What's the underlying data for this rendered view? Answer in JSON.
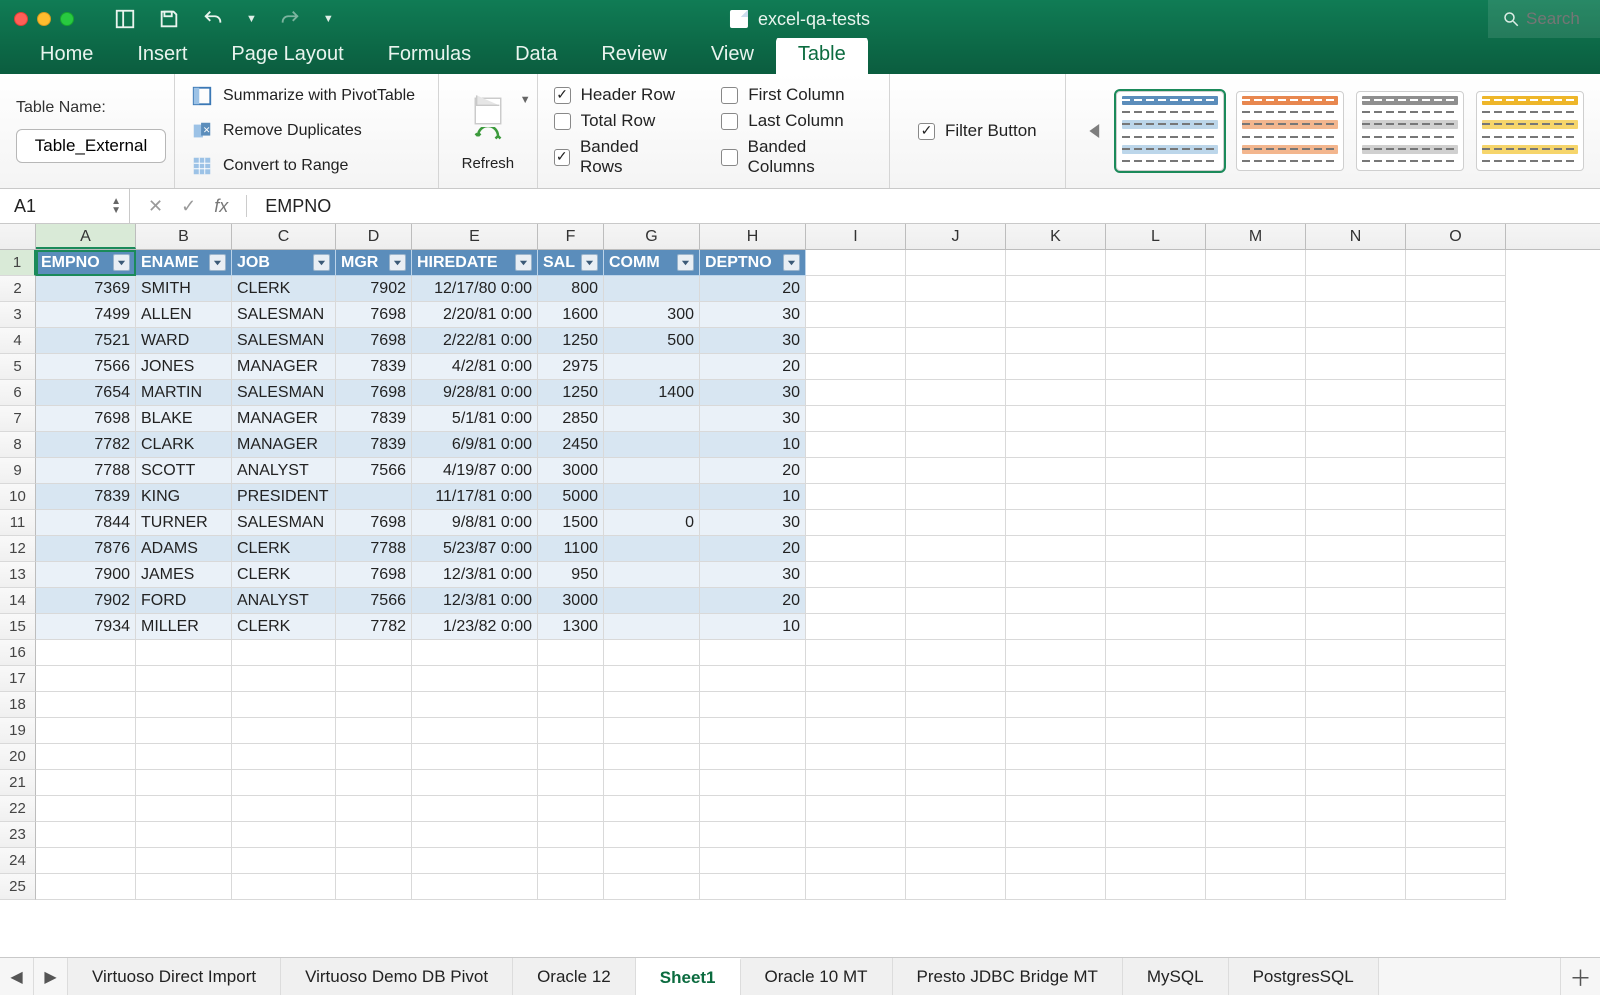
{
  "title": "excel-qa-tests",
  "search_placeholder": "Search",
  "tabs": [
    "Home",
    "Insert",
    "Page Layout",
    "Formulas",
    "Data",
    "Review",
    "View",
    "Table"
  ],
  "active_tab": "Table",
  "ribbon": {
    "table_name_label": "Table Name:",
    "table_name_value": "Table_External",
    "tools": {
      "pivot": "Summarize with PivotTable",
      "dup": "Remove Duplicates",
      "range": "Convert to Range"
    },
    "refresh_label": "Refresh",
    "options": {
      "header_row": {
        "label": "Header Row",
        "checked": true
      },
      "total_row": {
        "label": "Total Row",
        "checked": false
      },
      "banded_rows": {
        "label": "Banded Rows",
        "checked": true
      },
      "first_col": {
        "label": "First Column",
        "checked": false
      },
      "last_col": {
        "label": "Last Column",
        "checked": false
      },
      "banded_cols": {
        "label": "Banded Columns",
        "checked": false
      },
      "filter_btn": {
        "label": "Filter Button",
        "checked": true
      }
    }
  },
  "formula_bar": {
    "name": "A1",
    "formula": "EMPNO"
  },
  "grid": {
    "col_letters": [
      "A",
      "B",
      "C",
      "D",
      "E",
      "F",
      "G",
      "H",
      "I",
      "J",
      "K",
      "L",
      "M",
      "N",
      "O"
    ],
    "row_count": 25,
    "headers": [
      "EMPNO",
      "ENAME",
      "JOB",
      "MGR",
      "HIREDATE",
      "SAL",
      "COMM",
      "DEPTNO"
    ],
    "rows": [
      [
        "7369",
        "SMITH",
        "CLERK",
        "7902",
        "12/17/80 0:00",
        "800",
        "",
        "20"
      ],
      [
        "7499",
        "ALLEN",
        "SALESMAN",
        "7698",
        "2/20/81 0:00",
        "1600",
        "300",
        "30"
      ],
      [
        "7521",
        "WARD",
        "SALESMAN",
        "7698",
        "2/22/81 0:00",
        "1250",
        "500",
        "30"
      ],
      [
        "7566",
        "JONES",
        "MANAGER",
        "7839",
        "4/2/81 0:00",
        "2975",
        "",
        "20"
      ],
      [
        "7654",
        "MARTIN",
        "SALESMAN",
        "7698",
        "9/28/81 0:00",
        "1250",
        "1400",
        "30"
      ],
      [
        "7698",
        "BLAKE",
        "MANAGER",
        "7839",
        "5/1/81 0:00",
        "2850",
        "",
        "30"
      ],
      [
        "7782",
        "CLARK",
        "MANAGER",
        "7839",
        "6/9/81 0:00",
        "2450",
        "",
        "10"
      ],
      [
        "7788",
        "SCOTT",
        "ANALYST",
        "7566",
        "4/19/87 0:00",
        "3000",
        "",
        "20"
      ],
      [
        "7839",
        "KING",
        "PRESIDENT",
        "",
        "11/17/81 0:00",
        "5000",
        "",
        "10"
      ],
      [
        "7844",
        "TURNER",
        "SALESMAN",
        "7698",
        "9/8/81 0:00",
        "1500",
        "0",
        "30"
      ],
      [
        "7876",
        "ADAMS",
        "CLERK",
        "7788",
        "5/23/87 0:00",
        "1100",
        "",
        "20"
      ],
      [
        "7900",
        "JAMES",
        "CLERK",
        "7698",
        "12/3/81 0:00",
        "950",
        "",
        "30"
      ],
      [
        "7902",
        "FORD",
        "ANALYST",
        "7566",
        "12/3/81 0:00",
        "3000",
        "",
        "20"
      ],
      [
        "7934",
        "MILLER",
        "CLERK",
        "7782",
        "1/23/82 0:00",
        "1300",
        "",
        "10"
      ]
    ],
    "numeric_cols": [
      0,
      3,
      5,
      6,
      7
    ],
    "date_col": 4
  },
  "sheets": [
    "Virtuoso Direct Import",
    "Virtuoso Demo DB  Pivot",
    "Oracle 12",
    "Sheet1",
    "Oracle 10 MT",
    "Presto JDBC Bridge MT",
    "MySQL",
    "PostgresSQL"
  ],
  "active_sheet": "Sheet1",
  "style_colors": [
    [
      "#bcd6ea",
      "#5b8dbb"
    ],
    [
      "#f3b68e",
      "#e8874f"
    ],
    [
      "#d0d0d0",
      "#8f8f8f"
    ],
    [
      "#f6d56b",
      "#eeb62a"
    ]
  ]
}
